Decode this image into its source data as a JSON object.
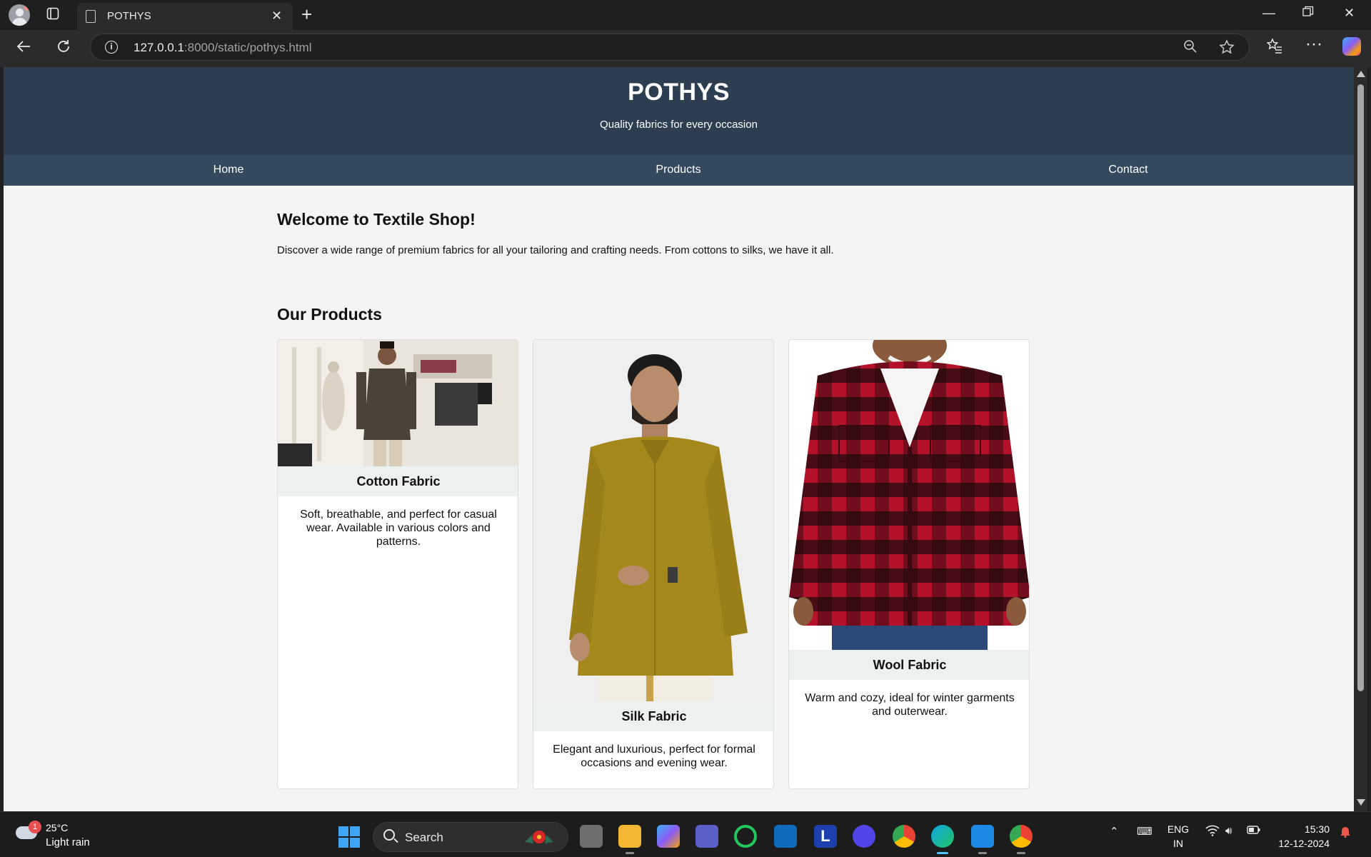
{
  "browser": {
    "tab_title": "POTHYS",
    "url_host": "127.0.0.1",
    "url_rest": ":8000/static/pothys.html"
  },
  "site": {
    "brand": "POTHYS",
    "tagline": "Quality fabrics for every occasion",
    "nav": [
      "Home",
      "Products",
      "Contact"
    ],
    "welcome_title": "Welcome to Textile Shop!",
    "welcome_text": "Discover a wide range of premium fabrics for all your tailoring and crafting needs. From cottons to silks, we have it all.",
    "products_title": "Our Products",
    "products": [
      {
        "name": "Cotton Fabric",
        "description": "Soft, breathable, and perfect for casual wear. Available in various colors and patterns."
      },
      {
        "name": "Silk Fabric",
        "description": "Elegant and luxurious, perfect for formal occasions and evening wear."
      },
      {
        "name": "Wool Fabric",
        "description": "Warm and cozy, ideal for winter garments and outerwear."
      }
    ]
  },
  "colors": {
    "header_bg": "#2c3e50",
    "nav_bg": "#34495e",
    "page_bg": "#f4f4f4",
    "card_title_bg": "#ecf0f1"
  },
  "taskbar": {
    "weather_badge": "1",
    "temperature": "25°C",
    "condition": "Light rain",
    "search_label": "Search",
    "lang_line1": "ENG",
    "lang_line2": "IN",
    "time": "15:30",
    "date": "12-12-2024"
  }
}
